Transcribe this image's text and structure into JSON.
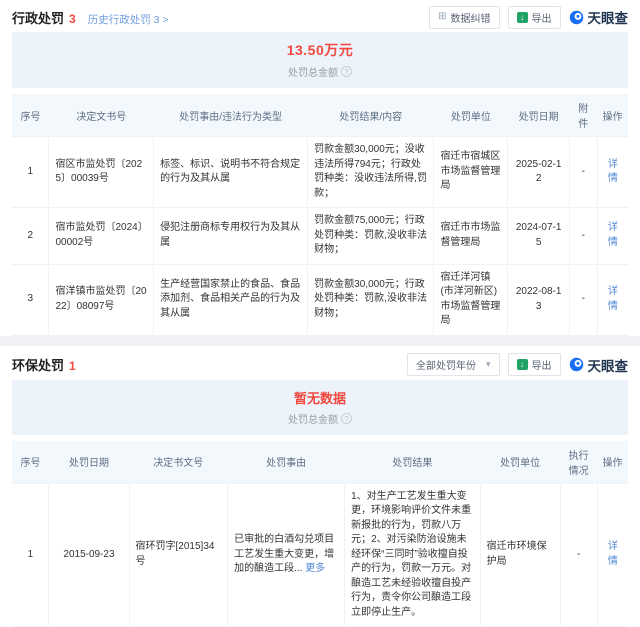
{
  "brand": {
    "logo_text": "天眼查"
  },
  "icons": {
    "export_arrow": "↓",
    "correction_glyph": "⊞",
    "caret_down": "▾",
    "help": "?"
  },
  "admin": {
    "title": "行政处罚",
    "count": "3",
    "history_link": "历史行政处罚 3 >",
    "correction_label": "数据纠错",
    "export_label": "导出",
    "total_amount": "13.50万元",
    "total_label": "处罚总金额",
    "columns": [
      "序号",
      "决定文书号",
      "处罚事由/违法行为类型",
      "处罚结果/内容",
      "处罚单位",
      "处罚日期",
      "附件",
      "操作"
    ],
    "rows": [
      {
        "no": "1",
        "doc": "宿区市监处罚〔2025〕00039号",
        "reason": "标签、标识、说明书不符合规定的行为及其从属",
        "result": "罚款金额30,000元；没收违法所得794元；行政处罚种类：没收违法所得,罚款；",
        "unit": "宿迁市宿城区市场监督管理局",
        "date": "2025-02-12",
        "attachment": "-",
        "action": "详情"
      },
      {
        "no": "2",
        "doc": "宿市监处罚〔2024〕00002号",
        "reason": "侵犯注册商标专用权行为及其从属",
        "result": "罚款金额75,000元；行政处罚种类：罚款,没收非法财物；",
        "unit": "宿迁市市场监督管理局",
        "date": "2024-07-15",
        "attachment": "-",
        "action": "详情"
      },
      {
        "no": "3",
        "doc": "宿洋镇市监处罚〔2022〕08097号",
        "reason": "生产经营国家禁止的食品、食品添加剂、食品相关产品的行为及其从属",
        "result": "罚款金额30,000元；行政处罚种类：罚款,没收非法财物；",
        "unit": "宿迁洋河镇(市洋河新区)市场监督管理局",
        "date": "2022-08-13",
        "attachment": "-",
        "action": "详情"
      }
    ]
  },
  "env": {
    "title": "环保处罚",
    "count": "1",
    "year_filter": "全部处罚年份",
    "export_label": "导出",
    "empty_text": "暂无数据",
    "total_label": "处罚总金额",
    "columns": [
      "序号",
      "处罚日期",
      "决定书文号",
      "处罚事由",
      "处罚结果",
      "处罚单位",
      "执行情况",
      "操作"
    ],
    "rows": [
      {
        "no": "1",
        "date": "2015-09-23",
        "doc": "宿环罚字[2015]34号",
        "reason": "已审批的白酒勾兑项目工艺发生重大变更，增加的酿造工段...",
        "more": "更多",
        "result": "1、对生产工艺发生重大变更，环境影响评价文件未重新报批的行为，罚款八万元；2、对污染防治设施未经环保“三同时”验收擅自投产的行为，罚款一万元。对酿造工艺未经验收擅自投产行为，责令你公司酿造工段立即停止生产。",
        "unit": "宿迁市环境保护局",
        "status": "-",
        "action": "详情"
      }
    ]
  }
}
